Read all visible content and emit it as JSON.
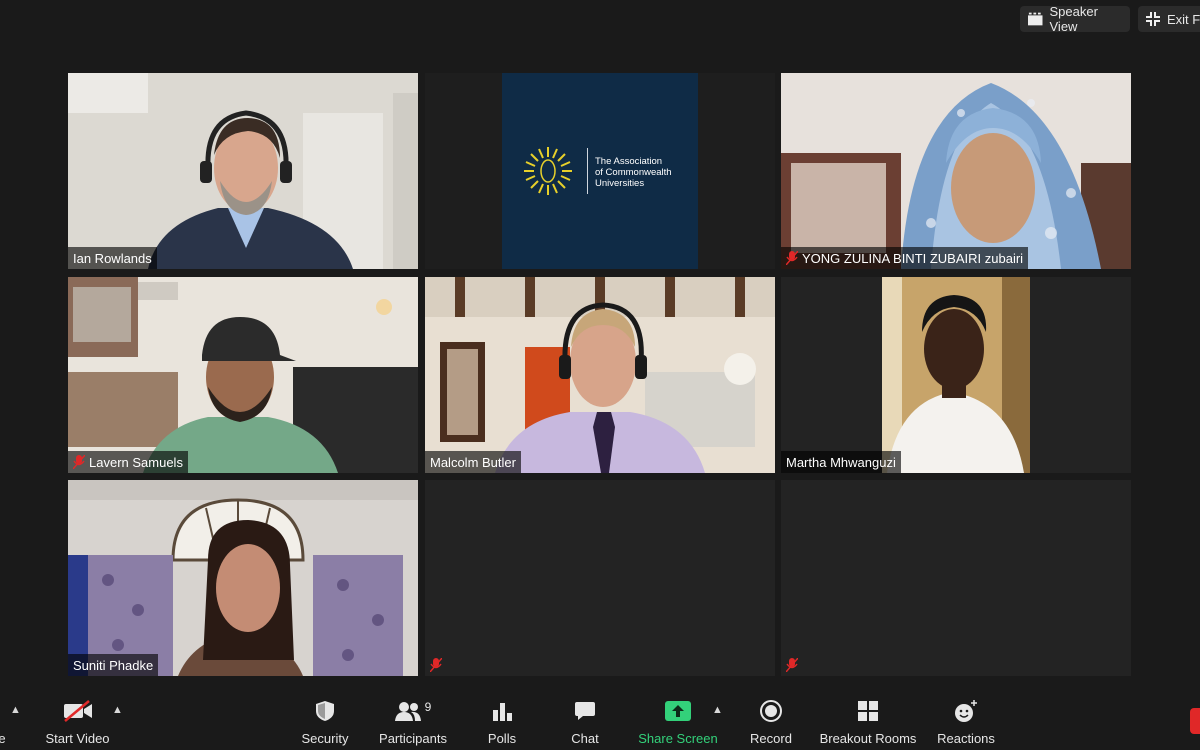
{
  "top_controls": {
    "speaker_view_label": "Speaker View",
    "exit_fullscreen_label": "Exit Fu"
  },
  "participants": {
    "ian": "Ian Rowlands",
    "acu_line1": "The Association",
    "acu_line2": "of Commonwealth",
    "acu_line3": "Universities",
    "yong": "YONG ZULINA BINTI ZUBAIRI zubairi",
    "lavern": "Lavern Samuels",
    "malcolm": "Malcolm Butler",
    "martha": "Martha Mhwanguzi",
    "suniti": "Suniti Phadke"
  },
  "toolbar": {
    "start_video_label": "Start Video",
    "security_label": "Security",
    "participants_label": "Participants",
    "participants_count": "9",
    "polls_label": "Polls",
    "chat_label": "Chat",
    "share_screen_label": "Share Screen",
    "record_label": "Record",
    "breakout_rooms_label": "Breakout Rooms",
    "reactions_label": "Reactions",
    "left_cut_label": "e"
  },
  "colors": {
    "active_speaker_border": "#d5e86a",
    "share_screen_green": "#33d17a",
    "muted_red": "#e02828",
    "acu_navy": "#0f2b46",
    "acu_yellow": "#e7d02a"
  }
}
